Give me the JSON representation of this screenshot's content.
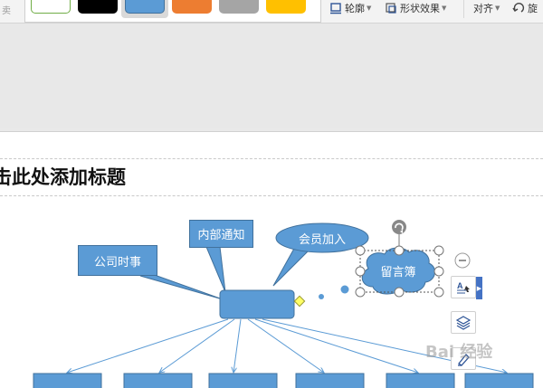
{
  "toolbar": {
    "left_fragment": "卖",
    "swatches": [
      {
        "name": "white-style",
        "fill": "#ffffff",
        "border": "#70ad47"
      },
      {
        "name": "black-style",
        "fill": "#000000",
        "border": "#000000"
      },
      {
        "name": "blue-style",
        "fill": "#5b9bd5",
        "border": "#41719c",
        "selected": true
      },
      {
        "name": "orange-style",
        "fill": "#ed7d31",
        "border": "#ae5a21"
      },
      {
        "name": "gray-style",
        "fill": "#a5a5a5",
        "border": "#7b7b7b"
      },
      {
        "name": "gold-style",
        "fill": "#ffc000",
        "border": "#bc8c00"
      }
    ],
    "outline_label": "轮廓",
    "effects_label": "形状效果",
    "align_label": "对齐",
    "rotate_label": "旋"
  },
  "slide": {
    "title": "击此处添加标题",
    "callouts": {
      "news": "公司时事",
      "notice": "内部通知",
      "members": "会员加入",
      "guestbook": "留言簿"
    }
  },
  "watermark": "Bai 经验",
  "colors": {
    "shape_fill": "#5b9bd5",
    "shape_border": "#41719c",
    "connector": "#5b9bd5",
    "handle": "#ffffff"
  }
}
